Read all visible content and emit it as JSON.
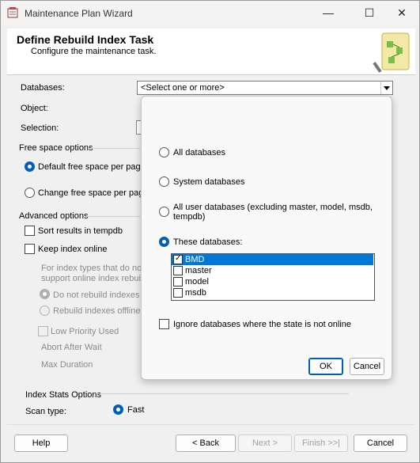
{
  "window": {
    "title": "Maintenance Plan Wizard",
    "min": "—",
    "max": "☐",
    "close": "✕"
  },
  "header": {
    "title": "Define Rebuild Index Task",
    "subtitle": "Configure the maintenance task."
  },
  "form": {
    "databases_label": "Databases:",
    "databases_value": "<Select one or more>",
    "object_label": "Object:",
    "selection_label": "Selection:",
    "free_space_group": "Free space options",
    "default_free_space": "Default free space per page",
    "change_free_space": "Change free space per page to",
    "advanced_group": "Advanced options",
    "sort_results": "Sort results in tempdb",
    "keep_online": "Keep index online",
    "online_note_1": "For index types that do not",
    "online_note_2": "support online index rebuilds",
    "do_not_rebuild": "Do not rebuild indexes",
    "rebuild_offline": "Rebuild indexes offline",
    "low_priority": "Low Priority Used",
    "abort_after_wait": "Abort After Wait",
    "max_duration": "Max Duration",
    "index_stats_group": "Index Stats Options",
    "scan_type": "Scan type:",
    "fast": "Fast"
  },
  "popup": {
    "all_databases": "All databases",
    "system_databases": "System databases",
    "user_databases_1": "All user databases  (excluding master, model, msdb,",
    "user_databases_2": "tempdb)",
    "these_databases": "These databases:",
    "db_list": [
      {
        "name": "BMD",
        "checked": true,
        "selected": true
      },
      {
        "name": "master",
        "checked": false,
        "selected": false
      },
      {
        "name": "model",
        "checked": false,
        "selected": false
      },
      {
        "name": "msdb",
        "checked": false,
        "selected": false
      }
    ],
    "ignore_offline": "Ignore databases where the state is not online",
    "ok": "OK",
    "cancel": "Cancel"
  },
  "footer": {
    "help": "Help",
    "back": "< Back",
    "next": "Next >",
    "finish": "Finish >>|",
    "cancel": "Cancel"
  }
}
